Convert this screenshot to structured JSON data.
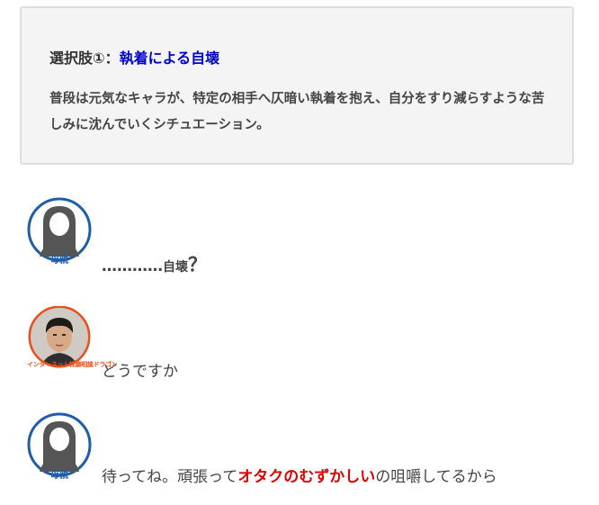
{
  "option": {
    "prefix": "選択肢①：",
    "title": "執着による自壊",
    "description": "普段は元気なキャラが、特定の相手へ仄暗い執着を抱え、自分をすり減らすような苦しみに沈んでいくシチュエーション。"
  },
  "messages": [
    {
      "speaker_label": "母親",
      "avatar_icon": "mother-silhouette-icon",
      "dots": "…………",
      "word": "自壊",
      "mark": "？"
    },
    {
      "speaker_label": "インターネット性癖相談ドラゴン",
      "avatar_icon": "person-photo-avatar",
      "text": "どうですか"
    },
    {
      "speaker_label": "母親",
      "avatar_icon": "mother-silhouette-icon",
      "before": "待ってね。頑張って",
      "highlight": "オタクのむずかしい",
      "after": "の咀嚼してるから"
    }
  ],
  "colors": {
    "link_blue": "#0000cc",
    "highlight_red": "#e00000",
    "mother_ring": "#1e5ea8",
    "dragon_ring": "#e8501c",
    "box_bg": "#f4f4f4"
  }
}
